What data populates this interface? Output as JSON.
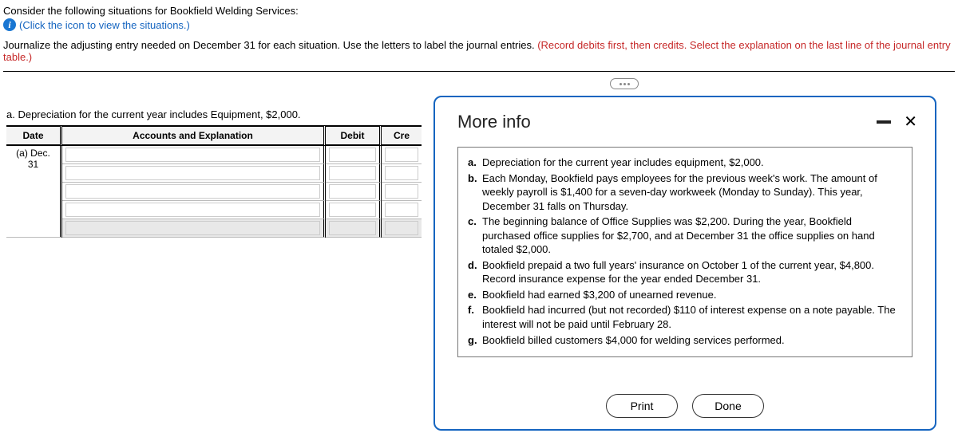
{
  "intro": {
    "line1": "Consider the following situations for Bookfield Welding Services:",
    "line2": "(Click the icon to view the situations.)",
    "line3a": "Journalize the adjusting entry needed on December 31 for each situation. Use the letters to label the journal entries. ",
    "line3b": "(Record debits first, then credits. Select the explanation on the last line of the journal entry table.)"
  },
  "sectionA": {
    "title": "a. Depreciation for the current year includes Equipment, $2,000.",
    "headers": {
      "date": "Date",
      "acct": "Accounts and Explanation",
      "debit": "Debit",
      "credit": "Cre"
    },
    "firstDate": "(a) Dec. 31"
  },
  "modal": {
    "title": "More info",
    "items": [
      {
        "lbl": "a.",
        "txt": "Depreciation for the current year includes equipment, $2,000."
      },
      {
        "lbl": "b.",
        "txt": "Each Monday, Bookfield pays employees for the previous week's work. The amount of weekly payroll is $1,400 for a seven-day workweek (Monday to Sunday). This year, December 31 falls on Thursday."
      },
      {
        "lbl": "c.",
        "txt": "The beginning balance of Office Supplies was $2,200. During the year, Bookfield purchased office supplies for $2,700, and at December 31 the office supplies on hand totaled $2,000."
      },
      {
        "lbl": "d.",
        "txt": "Bookfield prepaid a two full years' insurance on October 1 of the current year, $4,800. Record insurance expense for the year ended December 31."
      },
      {
        "lbl": "e.",
        "txt": "Bookfield had earned $3,200 of unearned revenue."
      },
      {
        "lbl": "f.",
        "txt": "Bookfield had incurred (but not recorded) $110 of interest expense on a note payable. The interest will not be paid until February 28."
      },
      {
        "lbl": "g.",
        "txt": "Bookfield billed customers $4,000 for welding services performed."
      }
    ],
    "buttons": {
      "print": "Print",
      "done": "Done"
    }
  }
}
